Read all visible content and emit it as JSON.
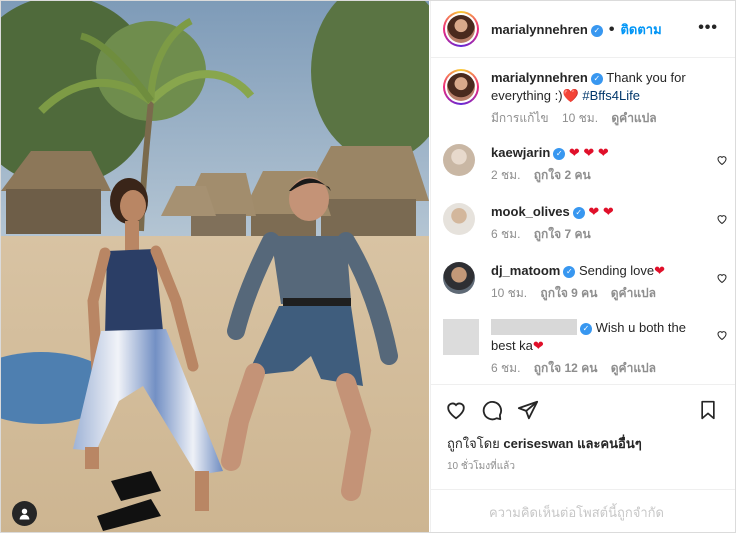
{
  "header": {
    "username": "marialynnehren",
    "verified_mark": "✓",
    "separator": "•",
    "follow_label": "ติดตาม",
    "more_label": "•••"
  },
  "caption": {
    "username": "marialynnehren",
    "text": "Thank you for everything :)",
    "emoji": "❤️",
    "hashtag": "#Bffs4Life",
    "edited_label": "มีการแก้ไข",
    "time": "10 ชม.",
    "translate_label": "ดูคำแปล"
  },
  "comments": [
    {
      "username": "kaewjarin",
      "text": "",
      "hearts": "❤ ❤ ❤",
      "time": "2 ชม.",
      "likes": "ถูกใจ 2 คน",
      "translate": ""
    },
    {
      "username": "mook_olives",
      "text": "",
      "hearts": "❤ ❤",
      "time": "6 ชม.",
      "likes": "ถูกใจ 7 คน",
      "translate": ""
    },
    {
      "username": "dj_matoom",
      "text": "Sending love",
      "hearts": "❤",
      "time": "10 ชม.",
      "likes": "ถูกใจ 9 คน",
      "translate": "ดูคำแปล"
    },
    {
      "username": "",
      "text": "Wish u both the best ka",
      "hearts": "❤",
      "time": "6 ชม.",
      "likes": "ถูกใจ 12 คน",
      "translate": "ดูคำแปล"
    }
  ],
  "actions": {
    "liked_by_prefix": "ถูกใจโดย",
    "liked_by_user": "ceriseswan",
    "liked_by_suffix": "และคนอื่นๆ",
    "time_ago": "10 ชั่วโมงที่แล้ว"
  },
  "footer": {
    "restricted_text": "ความคิดเห็นต่อโพสต์นี้ถูกจำกัด"
  },
  "colors": {
    "follow_blue": "#0095f6",
    "verified_blue": "#3897f0",
    "heart_red": "#e0102a",
    "muted_gray": "#8e8e8e"
  },
  "icons": [
    "heart-icon",
    "comment-icon",
    "share-icon",
    "bookmark-icon",
    "more-icon",
    "verified-icon",
    "user-icon"
  ]
}
